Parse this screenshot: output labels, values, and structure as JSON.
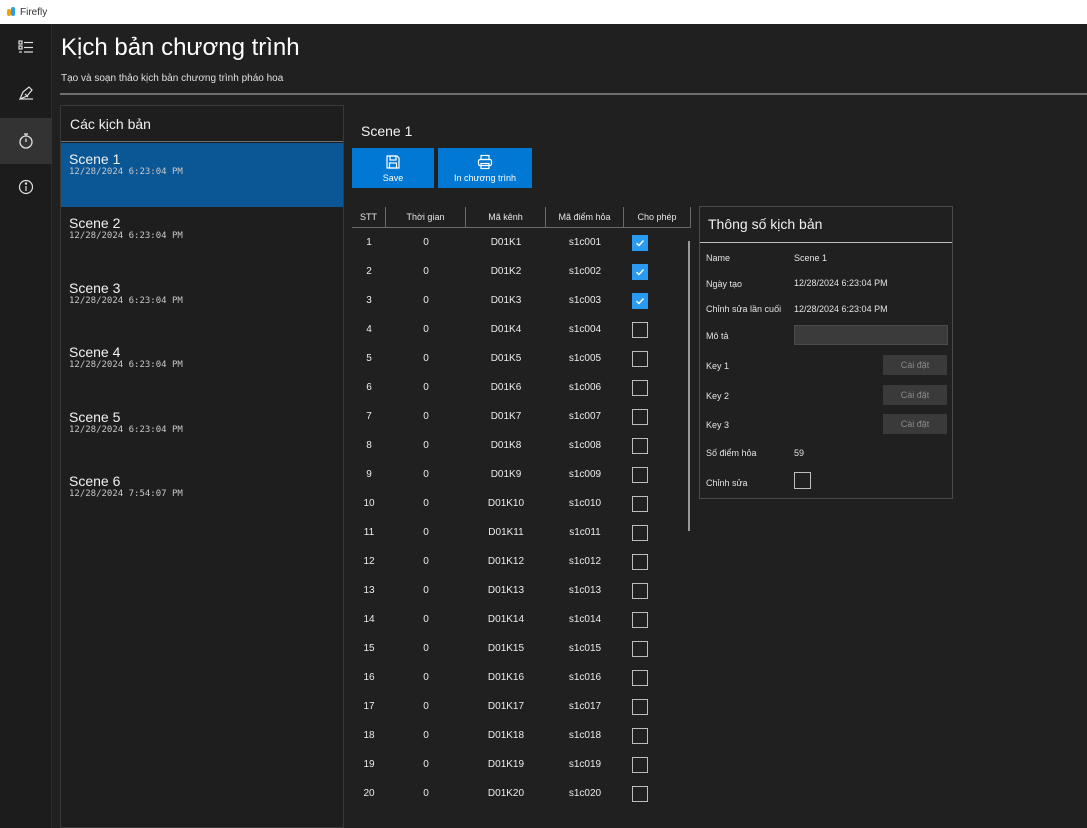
{
  "window": {
    "title": "Firefly"
  },
  "page": {
    "title": "Kịch bản chương trình",
    "subtitle": "Tạo và soạn thảo kịch bản chương trình pháo hoa"
  },
  "scene_panel": {
    "title": "Các kịch bản",
    "scenes": [
      {
        "name": "Scene 1",
        "date": "12/28/2024 6:23:04 PM",
        "selected": true
      },
      {
        "name": "Scene 2",
        "date": "12/28/2024 6:23:04 PM",
        "selected": false
      },
      {
        "name": "Scene 3",
        "date": "12/28/2024 6:23:04 PM",
        "selected": false
      },
      {
        "name": "Scene 4",
        "date": "12/28/2024 6:23:04 PM",
        "selected": false
      },
      {
        "name": "Scene 5",
        "date": "12/28/2024 6:23:04 PM",
        "selected": false
      },
      {
        "name": "Scene 6",
        "date": "12/28/2024 7:54:07 PM",
        "selected": false
      }
    ]
  },
  "editor": {
    "scene_title": "Scene 1",
    "save_label": "Save",
    "print_label": "In chương trình"
  },
  "grid": {
    "columns": [
      "STT",
      "Thời gian",
      "Mã kênh",
      "Mã điểm hỏa",
      "Cho phép"
    ],
    "rows": [
      {
        "stt": "1",
        "time": "0",
        "channel": "D01K1",
        "point": "s1c001",
        "enabled": true
      },
      {
        "stt": "2",
        "time": "0",
        "channel": "D01K2",
        "point": "s1c002",
        "enabled": true
      },
      {
        "stt": "3",
        "time": "0",
        "channel": "D01K3",
        "point": "s1c003",
        "enabled": true
      },
      {
        "stt": "4",
        "time": "0",
        "channel": "D01K4",
        "point": "s1c004",
        "enabled": false
      },
      {
        "stt": "5",
        "time": "0",
        "channel": "D01K5",
        "point": "s1c005",
        "enabled": false
      },
      {
        "stt": "6",
        "time": "0",
        "channel": "D01K6",
        "point": "s1c006",
        "enabled": false
      },
      {
        "stt": "7",
        "time": "0",
        "channel": "D01K7",
        "point": "s1c007",
        "enabled": false
      },
      {
        "stt": "8",
        "time": "0",
        "channel": "D01K8",
        "point": "s1c008",
        "enabled": false
      },
      {
        "stt": "9",
        "time": "0",
        "channel": "D01K9",
        "point": "s1c009",
        "enabled": false
      },
      {
        "stt": "10",
        "time": "0",
        "channel": "D01K10",
        "point": "s1c010",
        "enabled": false
      },
      {
        "stt": "11",
        "time": "0",
        "channel": "D01K11",
        "point": "s1c011",
        "enabled": false
      },
      {
        "stt": "12",
        "time": "0",
        "channel": "D01K12",
        "point": "s1c012",
        "enabled": false
      },
      {
        "stt": "13",
        "time": "0",
        "channel": "D01K13",
        "point": "s1c013",
        "enabled": false
      },
      {
        "stt": "14",
        "time": "0",
        "channel": "D01K14",
        "point": "s1c014",
        "enabled": false
      },
      {
        "stt": "15",
        "time": "0",
        "channel": "D01K15",
        "point": "s1c015",
        "enabled": false
      },
      {
        "stt": "16",
        "time": "0",
        "channel": "D01K16",
        "point": "s1c016",
        "enabled": false
      },
      {
        "stt": "17",
        "time": "0",
        "channel": "D01K17",
        "point": "s1c017",
        "enabled": false
      },
      {
        "stt": "18",
        "time": "0",
        "channel": "D01K18",
        "point": "s1c018",
        "enabled": false
      },
      {
        "stt": "19",
        "time": "0",
        "channel": "D01K19",
        "point": "s1c019",
        "enabled": false
      },
      {
        "stt": "20",
        "time": "0",
        "channel": "D01K20",
        "point": "s1c020",
        "enabled": false
      }
    ]
  },
  "properties": {
    "title": "Thông số kịch bản",
    "name_label": "Name",
    "name_value": "Scene 1",
    "created_label": "Ngày tạo",
    "created_value": "12/28/2024 6:23:04 PM",
    "modified_label": "Chỉnh sửa lần cuối",
    "modified_value": "12/28/2024 6:23:04 PM",
    "description_label": "Mô tả",
    "description_value": "",
    "key1_label": "Key 1",
    "key2_label": "Key 2",
    "key3_label": "Key 3",
    "setup_label": "Cài đặt",
    "points_label": "Số điểm hỏa",
    "points_value": "59",
    "edit_label": "Chỉnh sửa",
    "edit_checked": false
  },
  "colors": {
    "accent": "#0078d4",
    "selected_scene": "#0b5796",
    "checkbox_on": "#2b9af3",
    "background": "#202020"
  },
  "icons": {
    "nav": [
      "list-icon",
      "edit-script-icon",
      "stopwatch-icon",
      "info-icon"
    ],
    "save": "floppy-disk-icon",
    "print": "printer-icon"
  }
}
